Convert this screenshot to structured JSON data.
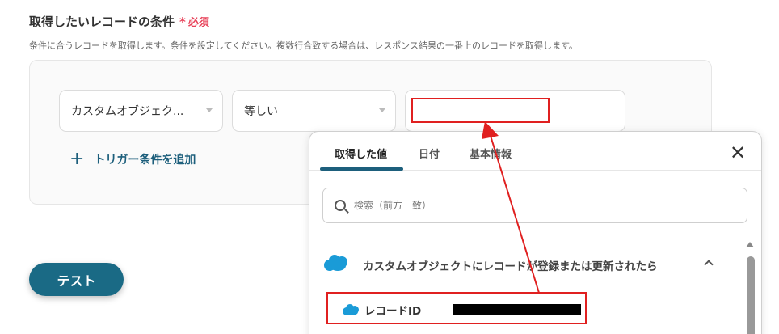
{
  "section": {
    "title": "取得したいレコードの条件",
    "required_star": "*",
    "required_label": "必須",
    "description": "条件に合うレコードを取得します。条件を設定してください。複数行合致する場合は、レスポンス結果の一番上のレコードを取得します。"
  },
  "condition": {
    "field_select": "カスタムオブジェク...",
    "operator_select": "等しい",
    "value": ""
  },
  "add_trigger": {
    "icon_glyph": "+",
    "label": "トリガー条件を追加"
  },
  "test_button": "テスト",
  "panel": {
    "tabs": [
      "取得した値",
      "日付",
      "基本情報"
    ],
    "active_tab": 0,
    "close_glyph": "✕",
    "search_placeholder": "検索（前方一致）",
    "group_label": "カスタムオブジェクトにレコードが登録または更新されたら",
    "record_item_label": "レコードID"
  },
  "colors": {
    "accent": "#1d5f7c",
    "test_button": "#1a6a85",
    "required": "#e8435a",
    "annotation": "#e02020",
    "salesforce_cloud": "#1a9bd7"
  },
  "icons": {
    "group_icon": "salesforce-cloud-icon",
    "record_icon": "salesforce-cloud-icon",
    "search_icon": "search-icon",
    "collapse_icon": "chevron-up-icon"
  }
}
